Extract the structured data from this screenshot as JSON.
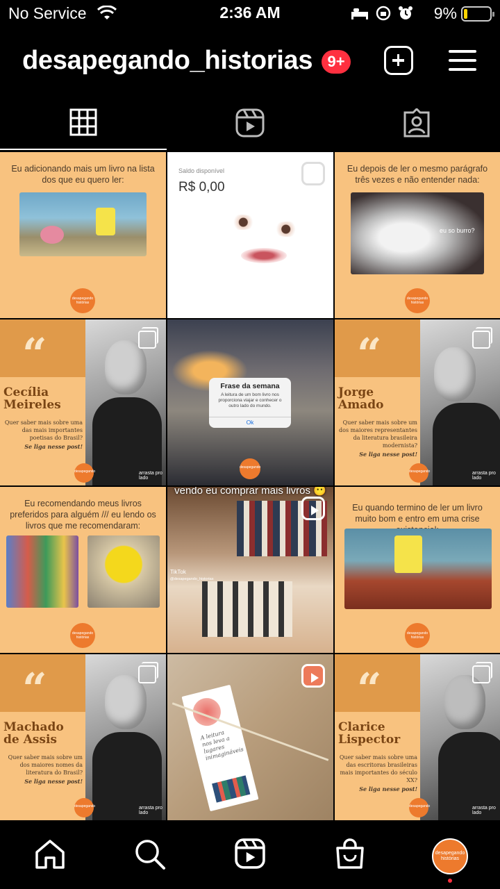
{
  "status_bar": {
    "carrier": "No Service",
    "time": "2:36 AM",
    "battery": "9%"
  },
  "header": {
    "username": "desapegando_historias",
    "notification_badge": "9+"
  },
  "tabs": [
    {
      "name": "grid",
      "icon": "grid-icon",
      "active": true
    },
    {
      "name": "reels",
      "icon": "reels-icon",
      "active": false
    },
    {
      "name": "tagged",
      "icon": "tagged-icon",
      "active": false
    }
  ],
  "posts": {
    "p1": {
      "caption": "Eu adicionando mais um livro na lista dos que eu quero ler:"
    },
    "p2": {
      "balance_label": "Saldo disponível",
      "balance_value": "R$ 0,00"
    },
    "p3": {
      "caption": "Eu depois de ler o mesmo parágrafo três vezes e não entender nada:",
      "gif_text": "eu so burro?"
    },
    "p4": {
      "name_line1": "Cecília",
      "name_line2": "Meireles",
      "question": "Quer saber mais sobre uma das mais importantes poetisas do Brasil?",
      "cta": "Se liga nesse post!",
      "swipe": "arrasta pro lado"
    },
    "p5": {
      "dialog_title": "Frase da semana",
      "dialog_text": "A leitura de um bom livro nos proporciona viajar e conhecer o outro lado do mundo.",
      "dialog_button": "Ok"
    },
    "p6": {
      "name_line1": "Jorge",
      "name_line2": "Amado",
      "question": "Quer saber mais sobre um dos maiores representantes da literatura brasileira modernista?",
      "cta": "Se liga nesse post!",
      "swipe": "arrasta pro lado"
    },
    "p7": {
      "caption": "Eu recomendando meus livros preferidos para alguém /// eu lendo os livros que me recomendaram:"
    },
    "p8": {
      "overlay": "vendo eu comprar mais livros 😶",
      "tiktok": "TikTok",
      "tiktok_handle": "@desapegando_historias"
    },
    "p9": {
      "caption": "Eu quando termino de ler um livro muito bom e entro em uma crise existencial:"
    },
    "p10": {
      "name_line1": "Machado",
      "name_line2": "de Assis",
      "question": "Quer saber mais sobre um dos maiores nomes da literatura do Brasil?",
      "cta": "Se liga nesse post!",
      "swipe": "arrasta pro lado"
    },
    "p11": {
      "bookmark_text": "A leitura nos leva a lugares inimagináveis"
    },
    "p12": {
      "name_line1": "Clarice",
      "name_line2": "Lispector",
      "question": "Quer saber mais sobre uma das escritoras brasileiras mais importantes do século XX?",
      "cta": "Se liga nesse post!",
      "swipe": "arrasta pro lado"
    }
  },
  "logo_text": {
    "line1": "desapegando",
    "line2": "histórias"
  },
  "bottom_nav": [
    {
      "name": "home",
      "icon": "home-icon"
    },
    {
      "name": "search",
      "icon": "search-icon"
    },
    {
      "name": "reels",
      "icon": "reels-icon"
    },
    {
      "name": "shop",
      "icon": "shop-icon"
    },
    {
      "name": "profile",
      "icon": "profile-avatar"
    }
  ],
  "colors": {
    "background": "#000000",
    "post_orange": "#f8c27f",
    "brand_orange": "#ed7a2d",
    "badge_red": "#ff3040"
  }
}
